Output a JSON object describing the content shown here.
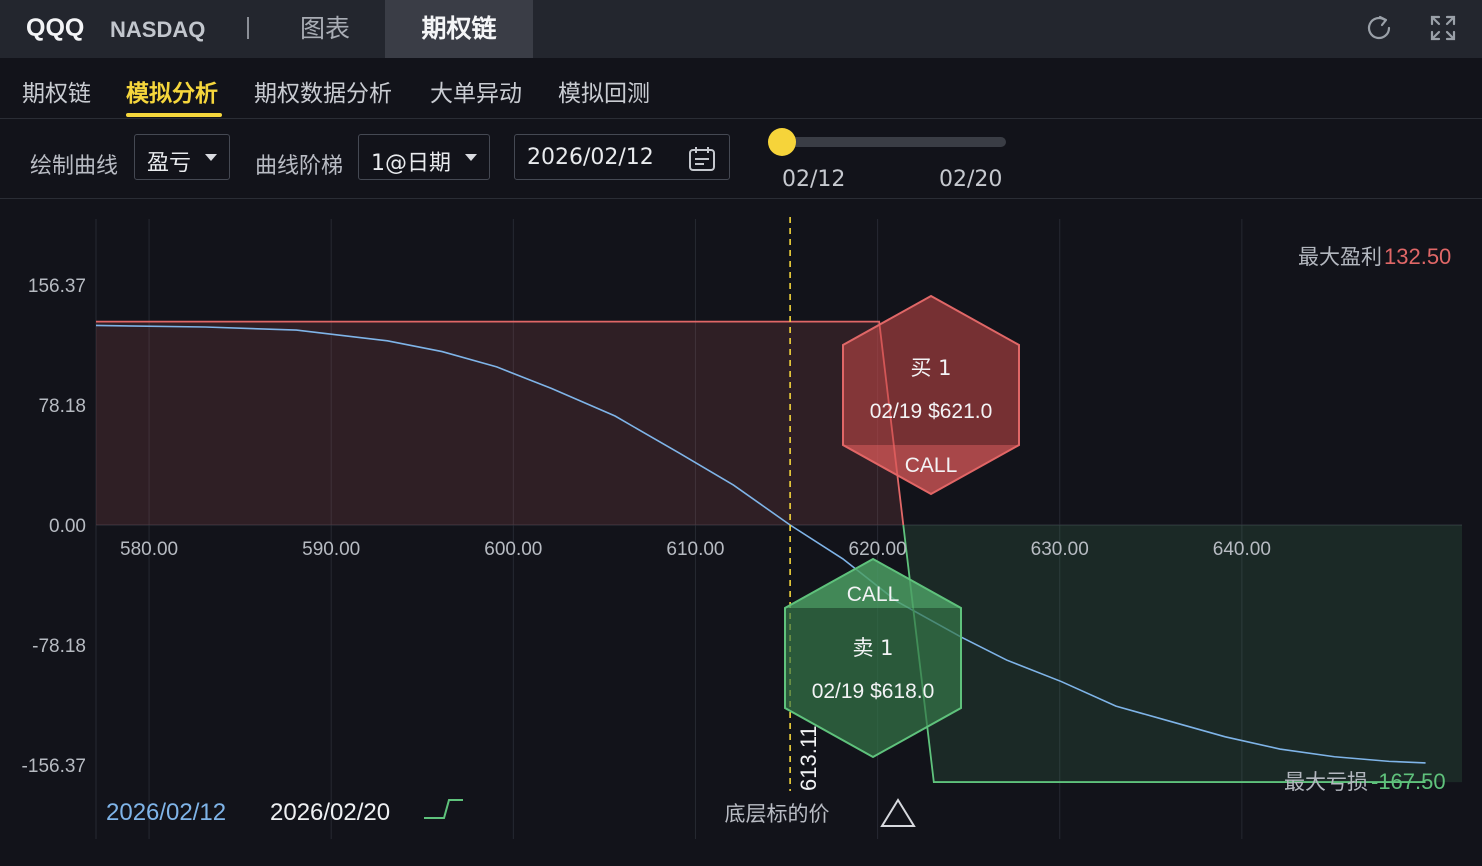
{
  "header": {
    "ticker": "QQQ",
    "exchange": "NASDAQ",
    "tabs": [
      "图表",
      "期权链"
    ],
    "active_tab": "期权链",
    "icons": [
      "refresh-icon",
      "expand-icon"
    ]
  },
  "subnav": {
    "tabs": [
      "期权链",
      "模拟分析",
      "期权数据分析",
      "大单异动",
      "模拟回测"
    ],
    "active": "模拟分析"
  },
  "controls": {
    "draw_curve_label": "绘制曲线",
    "draw_curve_value": "盈亏",
    "step_label": "曲线阶梯",
    "step_value": "1@日期",
    "date_value": "2026/02/12",
    "slider_labels": [
      "02/12",
      "02/20"
    ],
    "slider_position": 0
  },
  "legend": {
    "series_1": "2026/02/12",
    "series_2": "2026/02/20",
    "underlying_label": "底层标的价"
  },
  "stats": {
    "max_profit_label": "最大盈利",
    "max_profit_value": "132.50",
    "max_loss_label": "最大亏损",
    "max_loss_value": "-167.50"
  },
  "markers": {
    "buy": {
      "action": "买 1",
      "detail": "02/19 $621.0",
      "type": "CALL"
    },
    "sell": {
      "action": "卖 1",
      "detail": "02/19 $618.0",
      "type": "CALL"
    },
    "current_price": "613.11"
  },
  "colors": {
    "profit": "#e06767",
    "loss": "#5fc27c",
    "current_curve": "#7fb4e8",
    "accent": "#f5d63c"
  },
  "chart_data": {
    "type": "line",
    "xlim": [
      575,
      650
    ],
    "ylim": [
      -156.37,
      156.37
    ],
    "x_ticks": [
      580,
      590,
      600,
      610,
      620,
      630,
      640
    ],
    "x_tick_labels": [
      "580.00",
      "590.00",
      "600.00",
      "610.00",
      "620.00",
      "630.00",
      "640.00"
    ],
    "y_ticks": [
      156.37,
      78.18,
      0,
      -78.18,
      -156.37
    ],
    "y_tick_labels": [
      "156.37",
      "78.18",
      "0.00",
      "-78.18",
      "-156.37"
    ],
    "series": [
      {
        "name": "2026/02/12",
        "x": [
          575,
          581,
          586,
          591,
          594,
          597,
          600,
          603.5,
          607,
          610,
          613.11,
          616,
          619,
          622.5,
          625,
          628,
          631,
          634,
          637,
          640,
          643,
          646,
          648
        ],
        "y": [
          130,
          129,
          127,
          120,
          113,
          103,
          89,
          71,
          47,
          26,
          0,
          -22,
          -50,
          -73,
          -88,
          -102,
          -118,
          -128,
          -138,
          -146,
          -151,
          -154,
          -155
        ]
      },
      {
        "name": "2026/02/20",
        "x": [
          575,
          618,
          621,
          648
        ],
        "y": [
          132.5,
          132.5,
          -167.5,
          -167.5
        ]
      }
    ],
    "current_price": 613.11
  }
}
